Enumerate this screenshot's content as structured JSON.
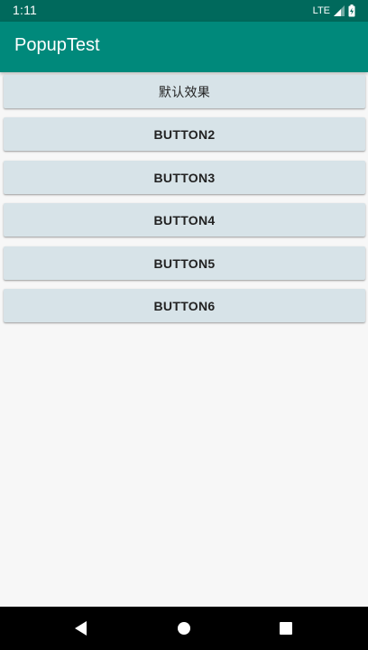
{
  "status_bar": {
    "time": "1:11",
    "network": "LTE",
    "signal_icon": "signal-icon",
    "battery_icon": "battery-charging-icon",
    "background": "#00695c"
  },
  "app_bar": {
    "title": "PopupTest",
    "background": "#00897b"
  },
  "buttons": [
    {
      "label": "默认效果"
    },
    {
      "label": "BUTTON2"
    },
    {
      "label": "BUTTON3"
    },
    {
      "label": "BUTTON4"
    },
    {
      "label": "BUTTON5"
    },
    {
      "label": "BUTTON6"
    }
  ],
  "colors": {
    "button_background": "#d7e3e8",
    "page_background": "#f7f7f7"
  },
  "nav_bar": {
    "back_icon": "back-icon",
    "home_icon": "home-icon",
    "recents_icon": "recents-icon"
  }
}
